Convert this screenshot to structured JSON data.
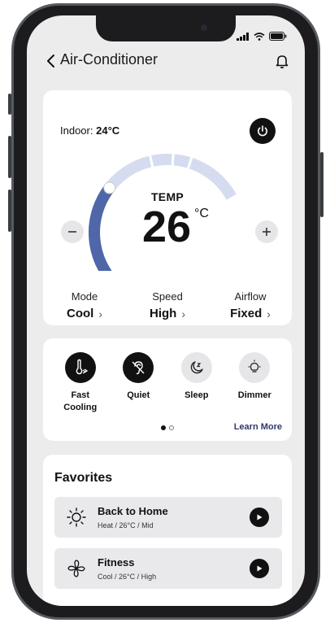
{
  "header": {
    "title": "Air-Conditioner"
  },
  "indoor": {
    "label": "Indoor:",
    "value": "24°C"
  },
  "thermostat": {
    "label": "TEMP",
    "value": "26",
    "unit": "°C",
    "level": 0.45
  },
  "controls": [
    {
      "label": "Mode",
      "value": "Cool"
    },
    {
      "label": "Speed",
      "value": "High"
    },
    {
      "label": "Airflow",
      "value": "Fixed"
    }
  ],
  "features": [
    {
      "label": "Fast\nCooling",
      "icon": "thermometer-icon",
      "active": true
    },
    {
      "label": "Quiet",
      "icon": "ear-off-icon",
      "active": true
    },
    {
      "label": "Sleep",
      "icon": "moon-zz-icon",
      "active": false
    },
    {
      "label": "Dimmer",
      "icon": "bulb-icon",
      "active": false
    }
  ],
  "pagination": {
    "current": 1,
    "total": 2
  },
  "learn_more": "Learn More",
  "favorites": {
    "title": "Favorites",
    "items": [
      {
        "name": "Back to Home",
        "detail": "Heat / 26°C / Mid",
        "icon": "sun-icon"
      },
      {
        "name": "Fitness",
        "detail": "Cool / 26°C / High",
        "icon": "fan-icon"
      }
    ]
  },
  "colors": {
    "accent": "#4f66a8",
    "track": "#d5dcf0",
    "dark": "#111111"
  }
}
